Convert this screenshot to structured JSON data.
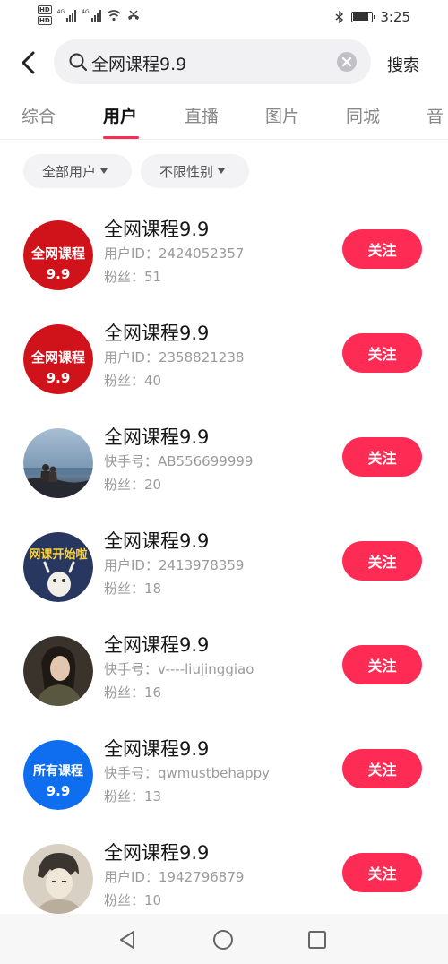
{
  "status_bar": {
    "hd_top": "HD",
    "hd_bottom": "HD",
    "network_1": "4G",
    "network_2": "4G",
    "time": "3:25"
  },
  "search": {
    "query": "全网课程9.9",
    "button_label": "搜索"
  },
  "tabs": [
    {
      "label": "综合",
      "active": false
    },
    {
      "label": "用户",
      "active": true
    },
    {
      "label": "直播",
      "active": false
    },
    {
      "label": "图片",
      "active": false
    },
    {
      "label": "同城",
      "active": false
    },
    {
      "label": "音",
      "active": false
    }
  ],
  "filters": {
    "user_type": "全部用户",
    "gender": "不限性别"
  },
  "users": [
    {
      "name": "全网课程9.9",
      "id_line": "用户ID：2424052357",
      "fans": "粉丝：51",
      "follow": "关注",
      "avatar_line1": "全网课程",
      "avatar_line2": "9.9",
      "avatar_color": "#d0121b"
    },
    {
      "name": "全网课程9.9",
      "id_line": "用户ID：2358821238",
      "fans": "粉丝：40",
      "follow": "关注",
      "avatar_line1": "全网课程",
      "avatar_line2": "9.9",
      "avatar_color": "#d0121b"
    },
    {
      "name": "全网课程9.9",
      "id_line": "快手号：AB556699999",
      "fans": "粉丝：20",
      "follow": "关注",
      "avatar_line1": "",
      "avatar_line2": "",
      "avatar_color": "#6f8aa6"
    },
    {
      "name": "全网课程9.9",
      "id_line": "用户ID：2413978359",
      "fans": "粉丝：18",
      "follow": "关注",
      "avatar_line1": "网课开始啦",
      "avatar_line2": "",
      "avatar_color": "#27375f"
    },
    {
      "name": "全网课程9.9",
      "id_line": "快手号：v----liujinggiao",
      "fans": "粉丝：16",
      "follow": "关注",
      "avatar_line1": "",
      "avatar_line2": "",
      "avatar_color": "#3a332b"
    },
    {
      "name": "全网课程9.9",
      "id_line": "快手号：qwmustbehappy",
      "fans": "粉丝：13",
      "follow": "关注",
      "avatar_line1": "所有课程",
      "avatar_line2": "9.9",
      "avatar_color": "#0f6ef0"
    },
    {
      "name": "全网课程9.9",
      "id_line": "用户ID：1942796879",
      "fans": "粉丝：10",
      "follow": "关注",
      "avatar_line1": "",
      "avatar_line2": "",
      "avatar_color": "#d8d0c2"
    }
  ],
  "icons": {
    "back": "back-arrow-icon",
    "search": "search-icon",
    "clear": "clear-icon",
    "nav_back": "triangle-back-icon",
    "nav_home": "circle-home-icon",
    "nav_recent": "square-recent-icon"
  },
  "colors": {
    "accent": "#fe2c55",
    "secondary_text": "#9b9b9b"
  }
}
